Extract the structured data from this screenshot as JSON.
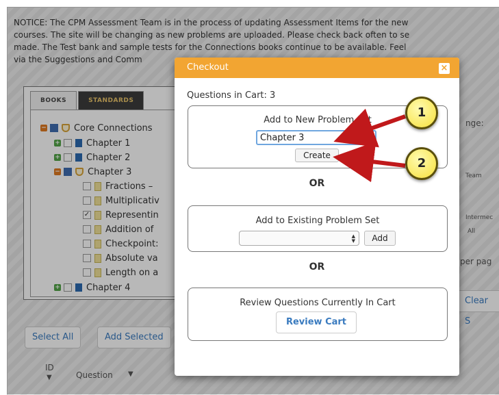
{
  "notice": {
    "lines": [
      "NOTICE: The CPM Assessment Team is in the process of updating Assessment Items for the new",
      "courses. The site will be changing as new problems are uploaded. Please check back often to se",
      "made. The Test bank and sample tests for the Connections books continue to be available. Feel",
      "via the Suggestions and Comm"
    ]
  },
  "tabs": {
    "books": "BOOKS",
    "standards": "STANDARDS"
  },
  "tree": [
    {
      "label": "Core Connections"
    },
    {
      "label": "Chapter 1"
    },
    {
      "label": "Chapter 2"
    },
    {
      "label": "Chapter 3"
    },
    {
      "label": "Fractions –"
    },
    {
      "label": "Multiplicativ"
    },
    {
      "label": "Representin"
    },
    {
      "label": "Addition of"
    },
    {
      "label": "Checkpoint:"
    },
    {
      "label": "Absolute va"
    },
    {
      "label": "Length on a"
    },
    {
      "label": "Chapter 4"
    }
  ],
  "background_buttons": {
    "select_all": "Select All",
    "add_selected": "Add Selected",
    "clear": "Clear S"
  },
  "background_labels": {
    "range": "nge:",
    "team": "Team",
    "intermediate": "Intermec",
    "all": "All",
    "per_page": "per pag"
  },
  "columns": {
    "id": "ID",
    "question": "Question"
  },
  "modal": {
    "title": "Checkout",
    "close": "×",
    "cart_count": "Questions in Cart: 3",
    "new_set_title": "Add to New Problem Set",
    "new_set_value": "Chapter 3",
    "create_label": "Create",
    "or": "OR",
    "existing_title": "Add to Existing Problem Set",
    "add_label": "Add",
    "review_title": "Review Questions Currently In Cart",
    "review_label": "Review Cart"
  },
  "annotations": {
    "badge1": "1",
    "badge2": "2"
  },
  "colors": {
    "modal_header": "#f2a532",
    "annotation_arrow": "#c0191b",
    "link_blue": "#3a7bbf"
  }
}
